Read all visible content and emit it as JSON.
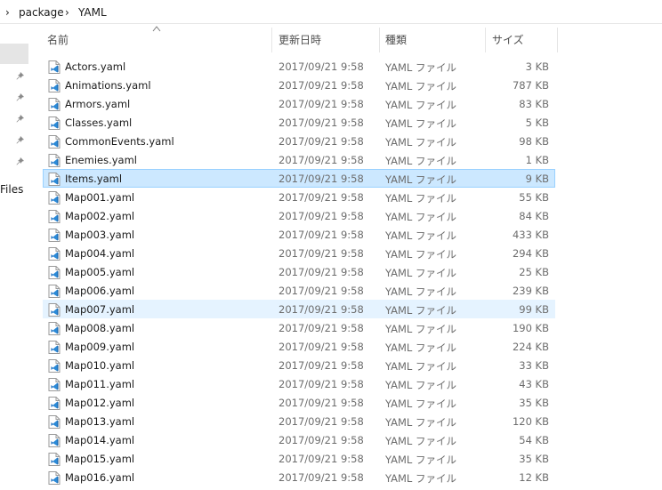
{
  "breadcrumb": {
    "items": [
      "package",
      "YAML"
    ]
  },
  "sidebar": {
    "files_label": "Files"
  },
  "columns": {
    "name": "名前",
    "date": "更新日時",
    "type": "種類",
    "size": "サイズ"
  },
  "selected_file": "Items.yaml",
  "hovered_file": "Map007.yaml",
  "files": [
    {
      "name": "Actors.yaml",
      "date": "2017/09/21 9:58",
      "type": "YAML ファイル",
      "size": "3 KB"
    },
    {
      "name": "Animations.yaml",
      "date": "2017/09/21 9:58",
      "type": "YAML ファイル",
      "size": "787 KB"
    },
    {
      "name": "Armors.yaml",
      "date": "2017/09/21 9:58",
      "type": "YAML ファイル",
      "size": "83 KB"
    },
    {
      "name": "Classes.yaml",
      "date": "2017/09/21 9:58",
      "type": "YAML ファイル",
      "size": "5 KB"
    },
    {
      "name": "CommonEvents.yaml",
      "date": "2017/09/21 9:58",
      "type": "YAML ファイル",
      "size": "98 KB"
    },
    {
      "name": "Enemies.yaml",
      "date": "2017/09/21 9:58",
      "type": "YAML ファイル",
      "size": "1 KB"
    },
    {
      "name": "Items.yaml",
      "date": "2017/09/21 9:58",
      "type": "YAML ファイル",
      "size": "9 KB"
    },
    {
      "name": "Map001.yaml",
      "date": "2017/09/21 9:58",
      "type": "YAML ファイル",
      "size": "55 KB"
    },
    {
      "name": "Map002.yaml",
      "date": "2017/09/21 9:58",
      "type": "YAML ファイル",
      "size": "84 KB"
    },
    {
      "name": "Map003.yaml",
      "date": "2017/09/21 9:58",
      "type": "YAML ファイル",
      "size": "433 KB"
    },
    {
      "name": "Map004.yaml",
      "date": "2017/09/21 9:58",
      "type": "YAML ファイル",
      "size": "294 KB"
    },
    {
      "name": "Map005.yaml",
      "date": "2017/09/21 9:58",
      "type": "YAML ファイル",
      "size": "25 KB"
    },
    {
      "name": "Map006.yaml",
      "date": "2017/09/21 9:58",
      "type": "YAML ファイル",
      "size": "239 KB"
    },
    {
      "name": "Map007.yaml",
      "date": "2017/09/21 9:58",
      "type": "YAML ファイル",
      "size": "99 KB"
    },
    {
      "name": "Map008.yaml",
      "date": "2017/09/21 9:58",
      "type": "YAML ファイル",
      "size": "190 KB"
    },
    {
      "name": "Map009.yaml",
      "date": "2017/09/21 9:58",
      "type": "YAML ファイル",
      "size": "224 KB"
    },
    {
      "name": "Map010.yaml",
      "date": "2017/09/21 9:58",
      "type": "YAML ファイル",
      "size": "33 KB"
    },
    {
      "name": "Map011.yaml",
      "date": "2017/09/21 9:58",
      "type": "YAML ファイル",
      "size": "43 KB"
    },
    {
      "name": "Map012.yaml",
      "date": "2017/09/21 9:58",
      "type": "YAML ファイル",
      "size": "35 KB"
    },
    {
      "name": "Map013.yaml",
      "date": "2017/09/21 9:58",
      "type": "YAML ファイル",
      "size": "120 KB"
    },
    {
      "name": "Map014.yaml",
      "date": "2017/09/21 9:58",
      "type": "YAML ファイル",
      "size": "54 KB"
    },
    {
      "name": "Map015.yaml",
      "date": "2017/09/21 9:58",
      "type": "YAML ファイル",
      "size": "35 KB"
    },
    {
      "name": "Map016.yaml",
      "date": "2017/09/21 9:58",
      "type": "YAML ファイル",
      "size": "12 KB"
    }
  ]
}
